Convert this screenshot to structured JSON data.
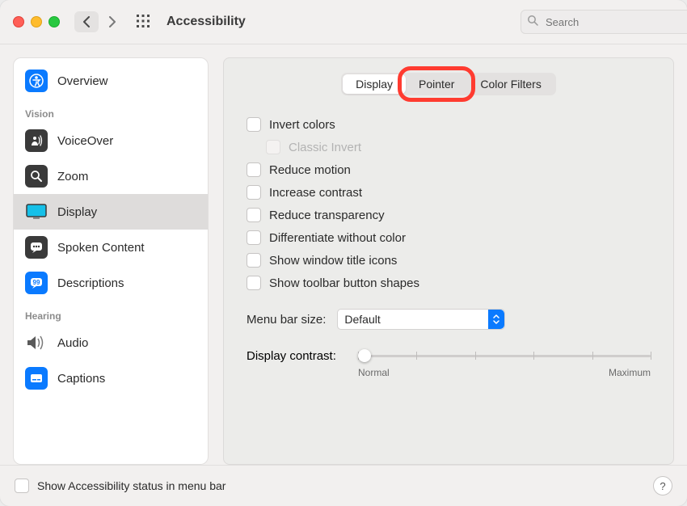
{
  "window": {
    "title": "Accessibility"
  },
  "search": {
    "placeholder": "Search"
  },
  "sidebar": {
    "items": [
      {
        "label": "Overview"
      },
      {
        "label": "VoiceOver"
      },
      {
        "label": "Zoom"
      },
      {
        "label": "Display"
      },
      {
        "label": "Spoken Content"
      },
      {
        "label": "Descriptions"
      },
      {
        "label": "Audio"
      },
      {
        "label": "Captions"
      }
    ],
    "headings": {
      "vision": "Vision",
      "hearing": "Hearing"
    }
  },
  "tabs": {
    "display": "Display",
    "pointer": "Pointer",
    "color_filters": "Color Filters"
  },
  "options": {
    "invert_colors": "Invert colors",
    "classic_invert": "Classic Invert",
    "reduce_motion": "Reduce motion",
    "increase_contrast": "Increase contrast",
    "reduce_transparency": "Reduce transparency",
    "differentiate_without_color": "Differentiate without color",
    "show_window_title_icons": "Show window title icons",
    "show_toolbar_button_shapes": "Show toolbar button shapes"
  },
  "menubar": {
    "label": "Menu bar size:",
    "value": "Default"
  },
  "contrast": {
    "label": "Display contrast:",
    "min": "Normal",
    "max": "Maximum"
  },
  "footer": {
    "show_status": "Show Accessibility status in menu bar"
  },
  "help": "?"
}
